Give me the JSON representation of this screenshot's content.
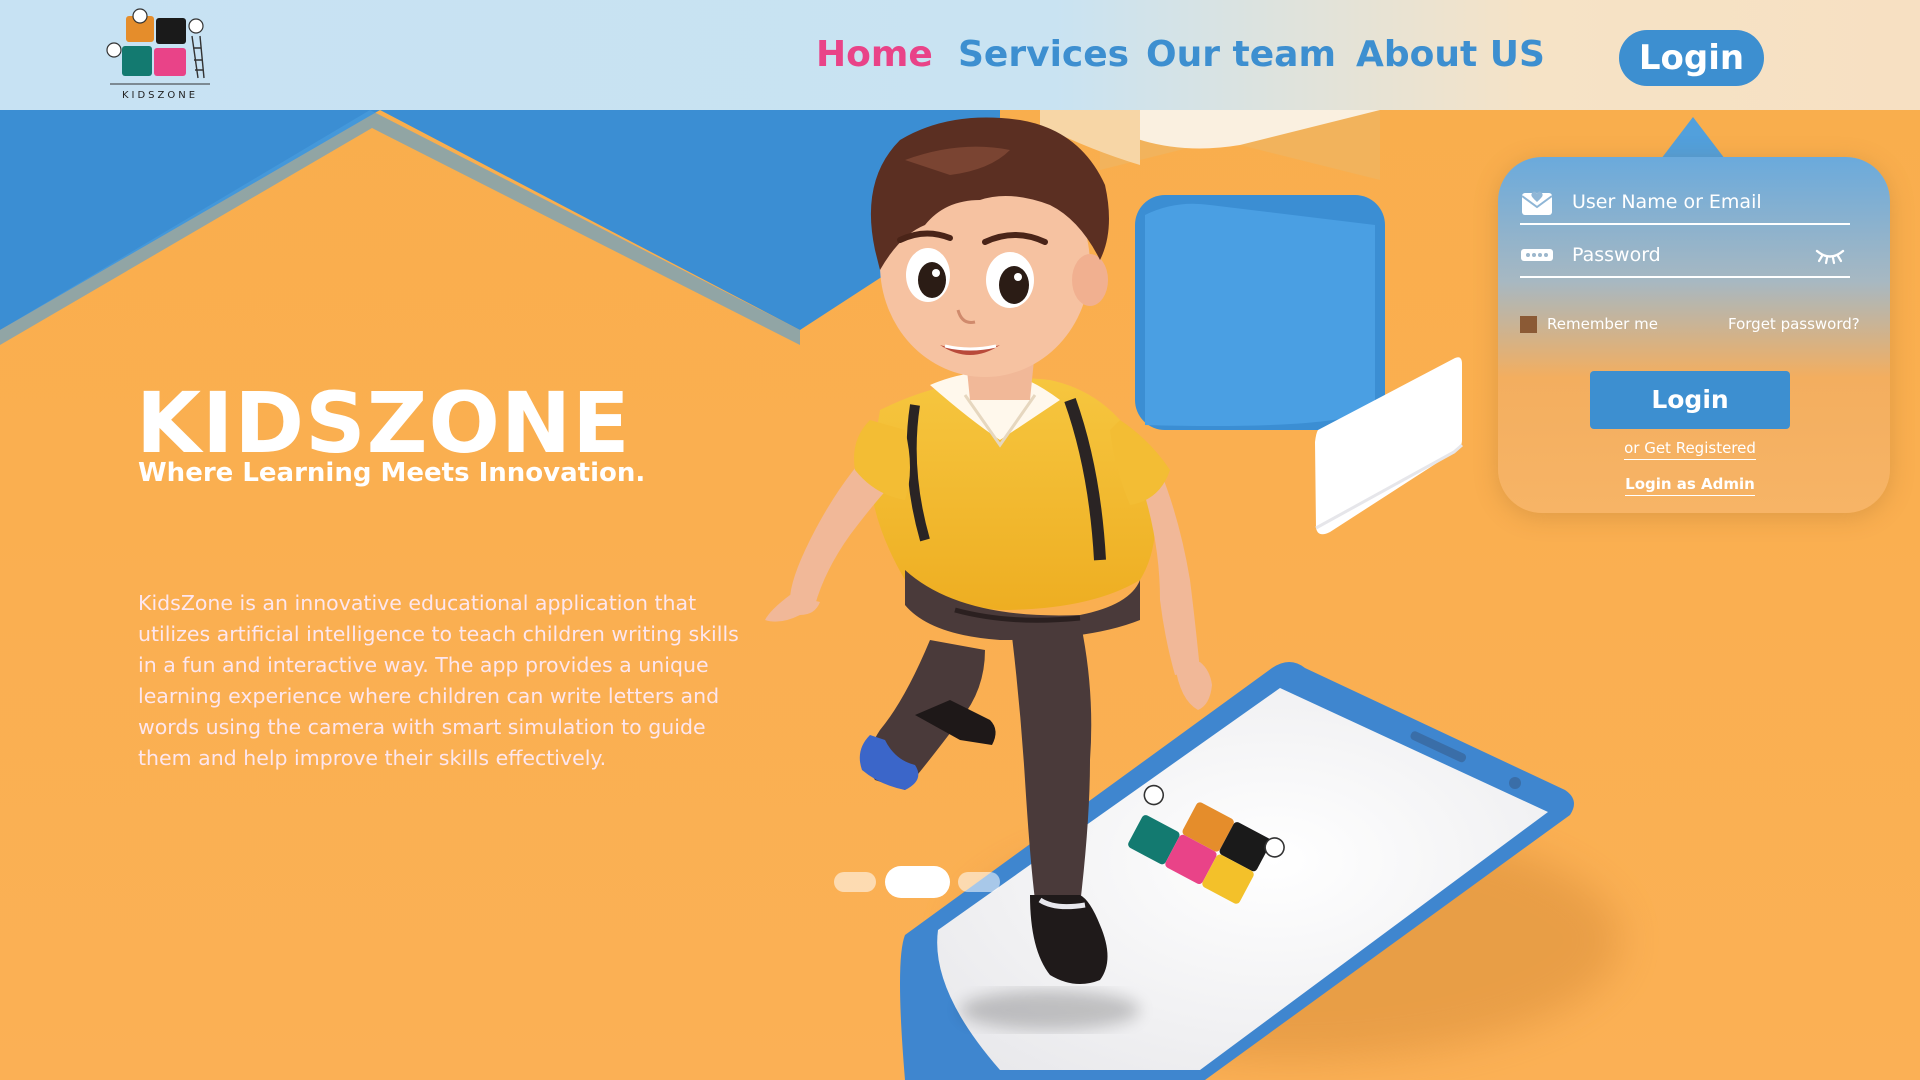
{
  "brand": {
    "logo_text": "KIDSZONE",
    "colors": {
      "orange": "#f9ae4c",
      "blue": "#3d8fd0",
      "pink": "#e94388",
      "teal": "#137a70",
      "black": "#1a1a1a"
    }
  },
  "nav": {
    "items": [
      {
        "label": "Home",
        "active": true
      },
      {
        "label": "Services",
        "active": false
      },
      {
        "label": "Our team",
        "active": false
      },
      {
        "label": "About US",
        "active": false
      }
    ],
    "login_label": "Login"
  },
  "hero": {
    "title": "KIDSZONE",
    "subtitle": "Where Learning Meets Innovation.",
    "description": "KidsZone is an innovative educational application that utilizes artificial intelligence to teach children writing skills in a fun and interactive way. The app provides a unique learning experience where children can write letters and words using the camera with smart simulation to guide them and help improve their skills effectively."
  },
  "slider": {
    "count": 3,
    "active_index": 1
  },
  "login_panel": {
    "username_placeholder": "User Name or Email",
    "password_placeholder": "Password",
    "remember_label": "Remember me",
    "forgot_label": "Forget password?",
    "button_label": "Login",
    "register_label": "or Get Registered",
    "admin_label": "Login as Admin"
  },
  "icons": [
    "mail-heart-icon",
    "password-dots-icon",
    "closed-eye-icon"
  ]
}
